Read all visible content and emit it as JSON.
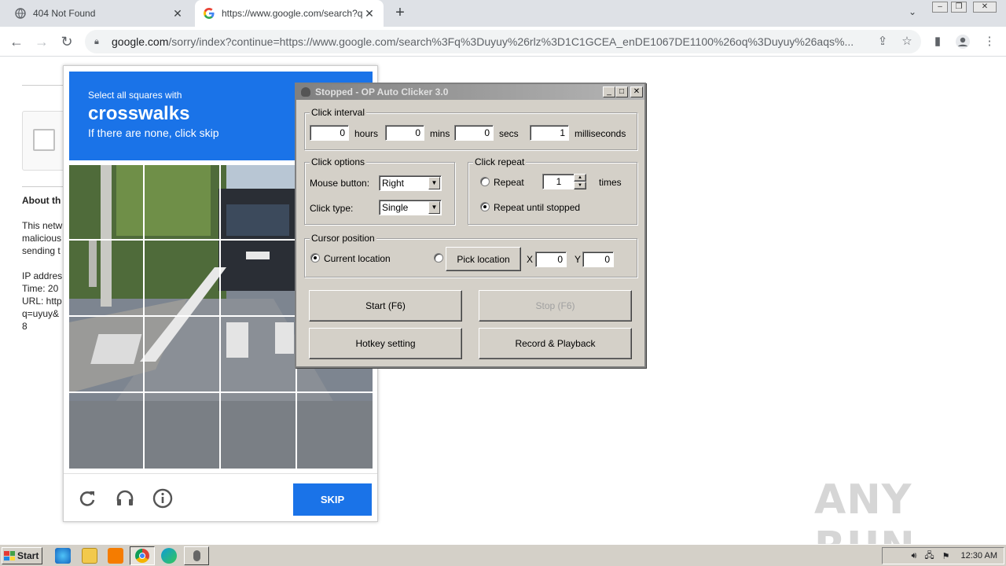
{
  "browser": {
    "tabs": [
      {
        "title": "404 Not Found",
        "active": false
      },
      {
        "title": "https://www.google.com/search?q=",
        "active": true
      }
    ],
    "url_host": "google.com",
    "url_rest": "/sorry/index?continue=https://www.google.com/search%3Fq%3Duyuy%26rlz%3D1C1GCEA_enDE1067DE1100%26oq%3Duyuy%26aqs%..."
  },
  "page": {
    "about_heading": "About th",
    "lines": [
      "This netw",
      "malicious",
      "sending t",
      "",
      "IP addres",
      "Time: 20",
      "URL: http",
      "q=uyuy&",
      "8"
    ]
  },
  "recaptcha": {
    "select_text": "Select all squares with",
    "target_word": "crosswalks",
    "none_text": "If there are none, click skip",
    "skip_label": "SKIP",
    "colors": {
      "header": "#1a73e8",
      "skip": "#1a73e8"
    }
  },
  "autoclicker": {
    "title": "Stopped - OP Auto Clicker 3.0",
    "click_interval": {
      "legend": "Click interval",
      "hours": "0",
      "hours_label": "hours",
      "mins": "0",
      "mins_label": "mins",
      "secs": "0",
      "secs_label": "secs",
      "ms": "1",
      "ms_label": "milliseconds"
    },
    "click_options": {
      "legend": "Click options",
      "mouse_label": "Mouse button:",
      "mouse_value": "Right",
      "type_label": "Click type:",
      "type_value": "Single"
    },
    "click_repeat": {
      "legend": "Click repeat",
      "repeat_label": "Repeat",
      "repeat_count": "1",
      "times_label": "times",
      "until_label": "Repeat until stopped"
    },
    "cursor": {
      "legend": "Cursor position",
      "current_label": "Current location",
      "pick_label": "Pick location",
      "x_label": "X",
      "x_value": "0",
      "y_label": "Y",
      "y_value": "0"
    },
    "buttons": {
      "start": "Start (F6)",
      "stop": "Stop (F6)",
      "hotkey": "Hotkey setting",
      "record": "Record & Playback"
    }
  },
  "taskbar": {
    "start_label": "Start",
    "clock": "12:30 AM"
  },
  "watermark": "ANY RUN"
}
